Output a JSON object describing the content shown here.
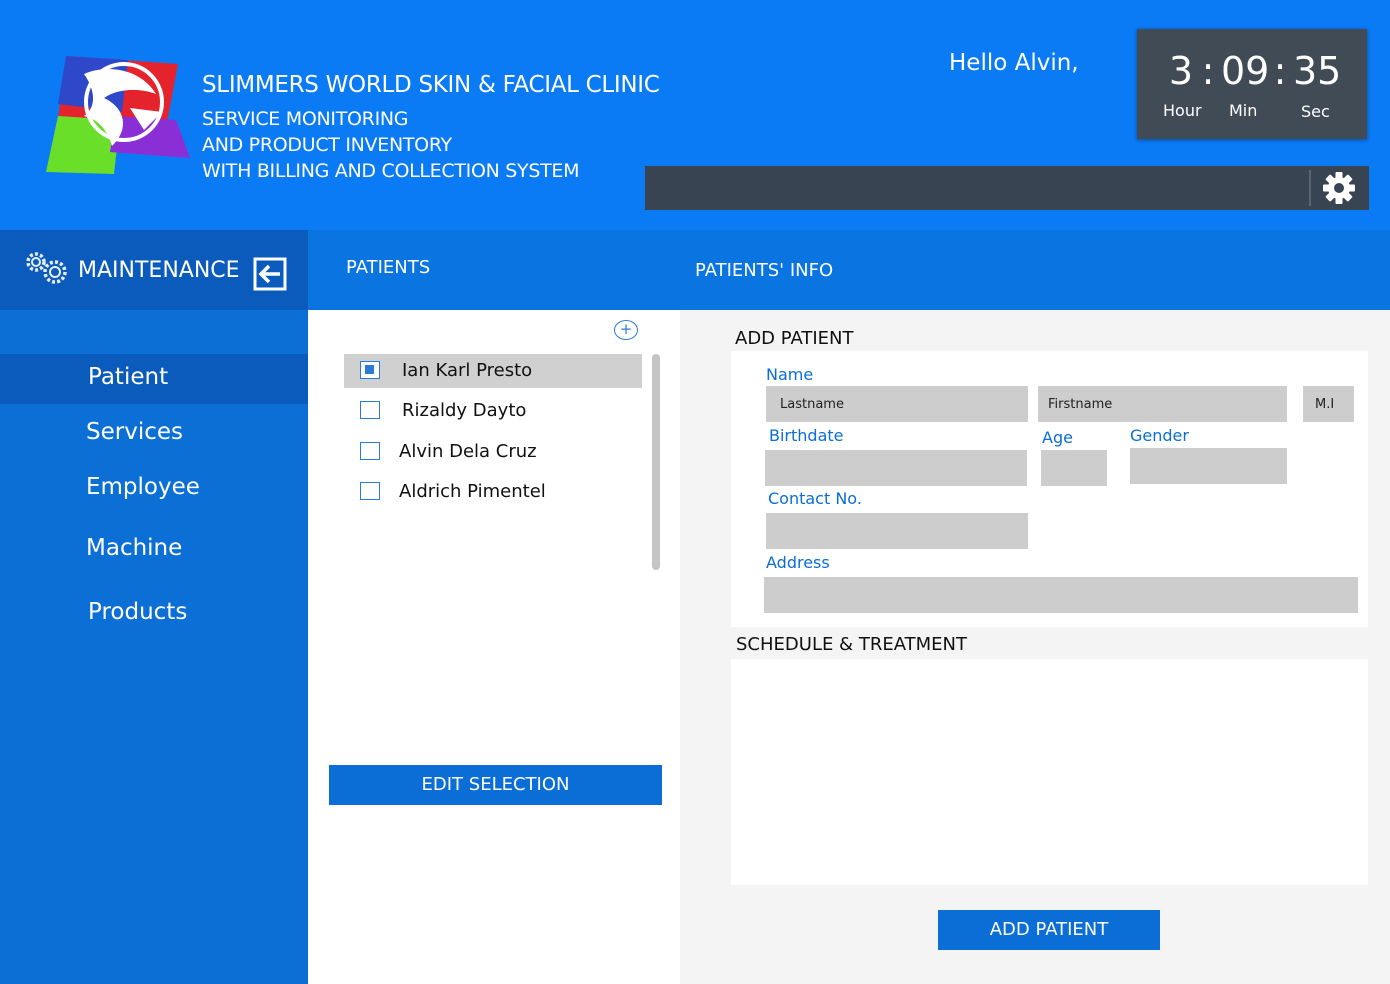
{
  "header": {
    "brand_title": "SLIMMERS WORLD  SKIN & FACIAL CLINIC",
    "brand_sub": [
      "SERVICE MONITORING",
      "AND PRODUCT INVENTORY",
      "WITH BILLING AND COLLECTION SYSTEM"
    ],
    "greeting": "Hello Alvin,",
    "clock": {
      "hour": "3",
      "min": "09",
      "sec": "35",
      "sep": ":",
      "hour_label": "Hour",
      "min_label": "Min",
      "sec_label": "Sec"
    },
    "settings_icon": "gear-icon"
  },
  "sidebar": {
    "title": "MAINTENANCE",
    "title_icon": "gears-icon",
    "back_icon": "back-arrow-icon",
    "items": [
      {
        "label": "Patient",
        "active": true
      },
      {
        "label": "Services",
        "active": false
      },
      {
        "label": "Employee",
        "active": false
      },
      {
        "label": "Machine",
        "active": false
      },
      {
        "label": "Products",
        "active": false
      }
    ]
  },
  "tabs": {
    "patients": "PATIENTS",
    "patients_info": "PATIENTS' INFO"
  },
  "patients": {
    "add_icon": "plus-circle-icon",
    "list": [
      {
        "name": "Ian Karl Presto",
        "checked": true
      },
      {
        "name": "Rizaldy Dayto",
        "checked": false
      },
      {
        "name": "Alvin Dela Cruz",
        "checked": false
      },
      {
        "name": "Aldrich Pimentel",
        "checked": false
      }
    ],
    "edit_button": "EDIT SELECTION"
  },
  "form": {
    "title": "ADD PATIENT",
    "name_label": "Name",
    "lastname_placeholder": "Lastname",
    "firstname_placeholder": "Firstname",
    "mi_placeholder": "M.I",
    "birthdate_label": "Birthdate",
    "age_label": "Age",
    "gender_label": "Gender",
    "contact_label": "Contact No.",
    "address_label": "Address",
    "schedule_title": "SCHEDULE & TREATMENT",
    "add_button": "ADD PATIENT"
  },
  "colors": {
    "header_blue": "#0a7af5",
    "sidebar_blue": "#0b6fd6",
    "sidebar_active": "#0b5bbd",
    "button_blue": "#0a6ed6",
    "clock_bg": "#404b56",
    "field_gray": "#cdcdcd"
  }
}
